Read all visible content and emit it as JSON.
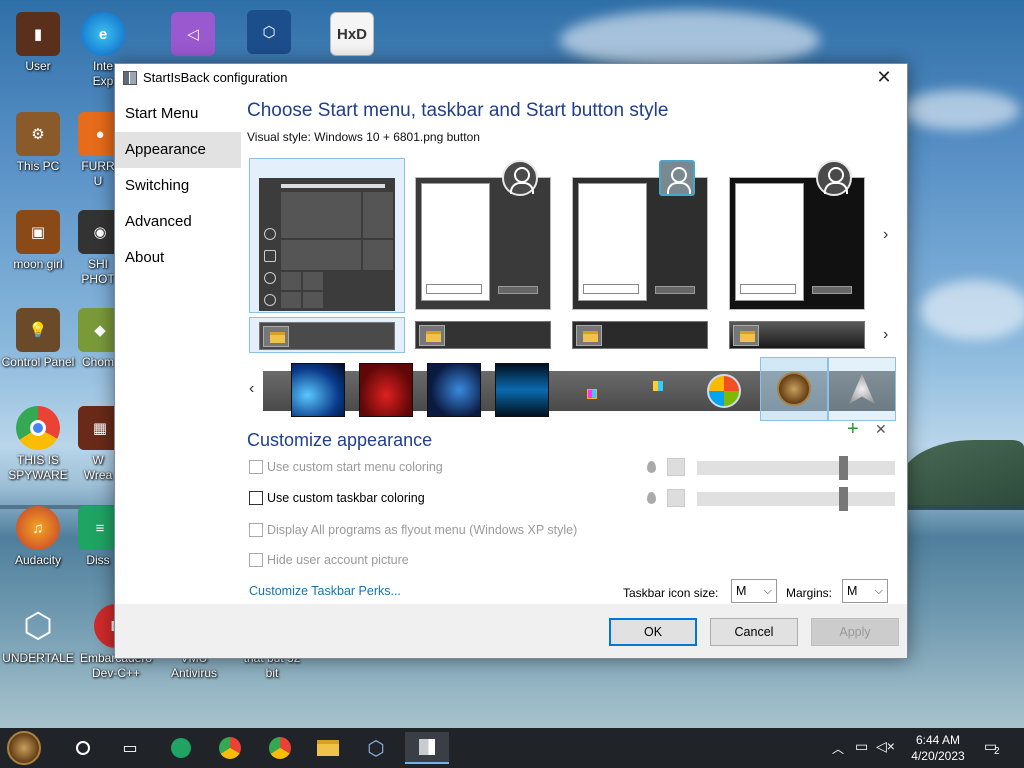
{
  "desktop": {
    "icons": [
      {
        "label": "User"
      },
      {
        "label": "Inte\nExp"
      },
      {
        "label": "This PC"
      },
      {
        "label": "FURR\nU"
      },
      {
        "label": "moon girl"
      },
      {
        "label": "SHI\nPHOT"
      },
      {
        "label": "Control Panel"
      },
      {
        "label": "Chom"
      },
      {
        "label": "THIS IS\nSPYWARE"
      },
      {
        "label": "W\nWrea"
      },
      {
        "label": "Audacity"
      },
      {
        "label": "Diss"
      },
      {
        "label": "UNDERTALE"
      },
      {
        "label": "Embarcadero\nDev-C++"
      },
      {
        "label": "VMU\nAntivirus"
      },
      {
        "label": "that but 32\nbit"
      }
    ]
  },
  "dialog": {
    "title": "StartIsBack configuration",
    "close_glyph": "✕",
    "nav": [
      "Start Menu",
      "Appearance",
      "Switching",
      "Advanced",
      "About"
    ],
    "active_nav": "Appearance",
    "heading": "Choose Start menu, taskbar and Start button style",
    "visual_style_label": "Visual style:",
    "visual_style_value": "Windows 10 + 6801.png button",
    "customize_heading": "Customize appearance",
    "options": [
      {
        "label": "Use custom start menu coloring",
        "checked": false,
        "enabled": false
      },
      {
        "label": "Use custom taskbar coloring",
        "checked": false,
        "enabled": true
      },
      {
        "label": "Display All programs as flyout menu (Windows XP style)",
        "checked": false,
        "enabled": false
      },
      {
        "label": "Hide user account picture",
        "checked": false,
        "enabled": false
      }
    ],
    "start_menu_color_level": 0.75,
    "taskbar_color_level": 0.75,
    "perks_link": "Customize Taskbar Perks...",
    "icon_size_label": "Taskbar icon size:",
    "icon_size_value": "M",
    "margins_label": "Margins:",
    "margins_value": "M",
    "add_glyph": "+",
    "remove_glyph": "✕",
    "ok": "OK",
    "cancel": "Cancel",
    "apply": "Apply",
    "colors": {
      "accent": "#1f3f8f",
      "link": "#1a73a8",
      "selection": "#e3f0fb",
      "selection_border": "#8cc0e6"
    }
  },
  "taskbar": {
    "time": "6:44 AM",
    "date": "4/20/2023",
    "notification_count": "2",
    "pinned": [
      "start-orb-icon",
      "cortana-icon",
      "task-view-icon",
      "sheets-icon",
      "chrome-icon",
      "chrome-alt-icon",
      "file-explorer-icon",
      "virtualbox-icon",
      "startisback-config-icon"
    ]
  }
}
